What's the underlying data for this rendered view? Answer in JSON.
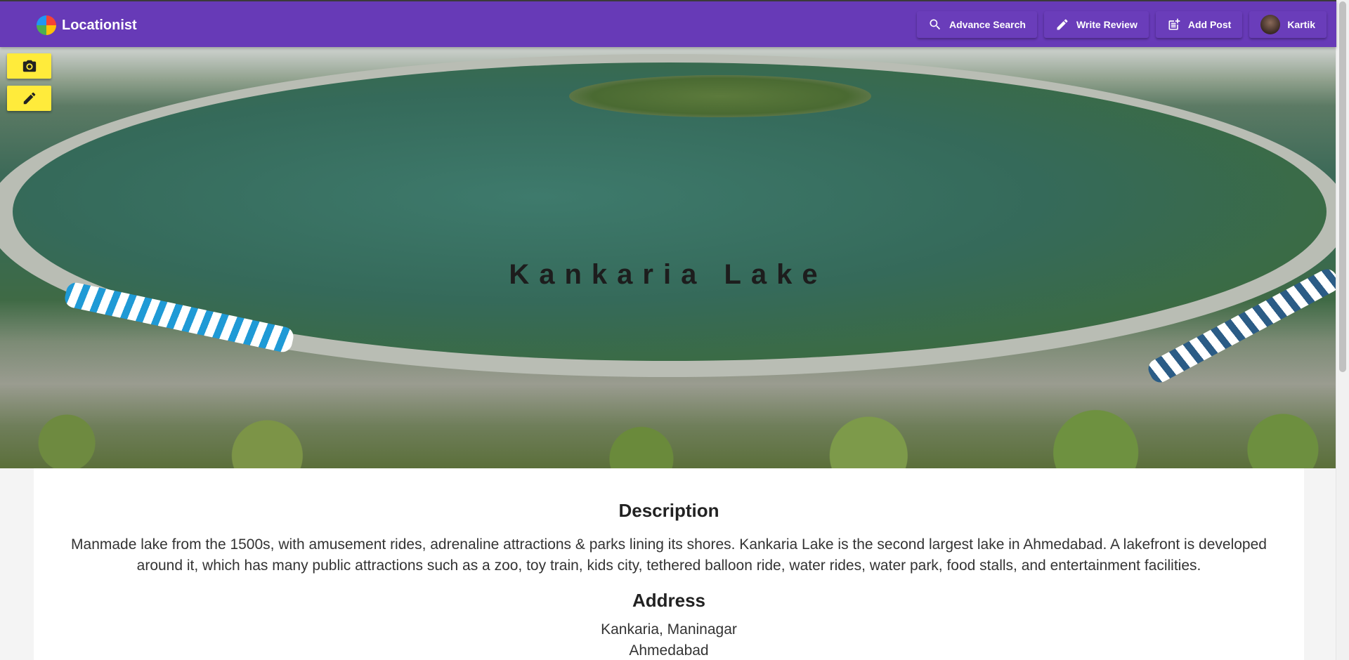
{
  "app": {
    "name": "Locationist",
    "logo_icon": "globe-logo-icon"
  },
  "nav": {
    "advance_search": "Advance Search",
    "write_review": "Write Review",
    "add_post": "Add Post",
    "user": "Kartik"
  },
  "hero": {
    "title": "Kankaria Lake"
  },
  "side_actions": [
    {
      "icon": "camera-icon"
    },
    {
      "icon": "pencil-icon"
    }
  ],
  "description": {
    "title": "Description",
    "text": "Manmade lake from the 1500s, with amusement rides, adrenaline attractions & parks lining its shores. Kankaria Lake is the second largest lake in Ahmedabad. A lakefront is developed around it, which has many public attractions such as a zoo, toy train, kids city, tethered balloon ride, water rides, water park, food stalls, and entertainment facilities."
  },
  "address": {
    "title": "Address",
    "line1": "Kankaria, Maninagar",
    "line2": "Ahmedabad"
  },
  "colors": {
    "primary": "#673ab7",
    "accent": "#ffeb3b"
  }
}
